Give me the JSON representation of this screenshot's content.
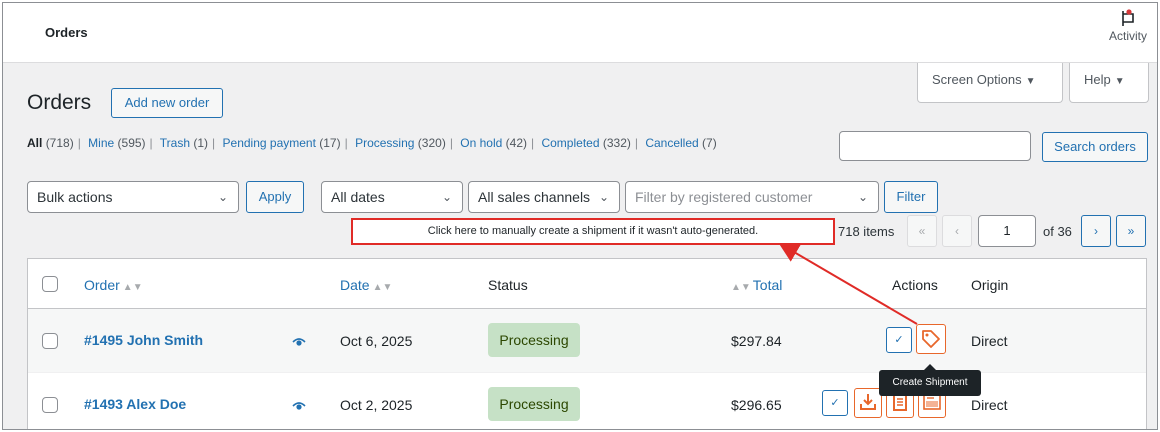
{
  "topbar": {
    "title": "Orders",
    "activity_label": "Activity"
  },
  "tabs": {
    "screen_options": "Screen Options",
    "help": "Help"
  },
  "page": {
    "title": "Orders",
    "add_new": "Add new order"
  },
  "views": [
    {
      "label": "All",
      "count": "(718)"
    },
    {
      "label": "Mine",
      "count": "(595)"
    },
    {
      "label": "Trash",
      "count": "(1)"
    },
    {
      "label": "Pending payment",
      "count": "(17)"
    },
    {
      "label": "Processing",
      "count": "(320)"
    },
    {
      "label": "On hold",
      "count": "(42)"
    },
    {
      "label": "Completed",
      "count": "(332)"
    },
    {
      "label": "Cancelled",
      "count": "(7)"
    }
  ],
  "search": {
    "button": "Search orders",
    "value": ""
  },
  "filters": {
    "bulk_actions": "Bulk actions",
    "apply": "Apply",
    "dates": "All dates",
    "channels": "All sales channels",
    "customer_placeholder": "Filter by registered customer",
    "filter": "Filter"
  },
  "callout": "Click here to manually create a shipment if it wasn't auto-generated.",
  "pagination": {
    "items": "718 items",
    "first": "«",
    "prev": "‹",
    "current": "1",
    "of": "of 36",
    "next": "›",
    "last": "»"
  },
  "columns": {
    "order": "Order",
    "date": "Date",
    "status": "Status",
    "total": "Total",
    "actions": "Actions",
    "origin": "Origin"
  },
  "rows": [
    {
      "order": "#1495 John Smith",
      "date": "Oct 6, 2025",
      "status": "Processing",
      "total": "$297.84",
      "origin": "Direct"
    },
    {
      "order": "#1493 Alex Doe",
      "date": "Oct 2, 2025",
      "status": "Processing",
      "total": "$296.65",
      "origin": "Direct"
    }
  ],
  "tooltip": "Create Shipment",
  "colors": {
    "accent": "#2271b1",
    "status_processing_bg": "#c6e1c6",
    "callout_red": "#e02b27",
    "action_orange": "#e8672b"
  },
  "icons": [
    "flag-icon",
    "eye-icon",
    "check-icon",
    "tag-icon",
    "download-icon",
    "document-icon",
    "barcode-label-icon"
  ]
}
